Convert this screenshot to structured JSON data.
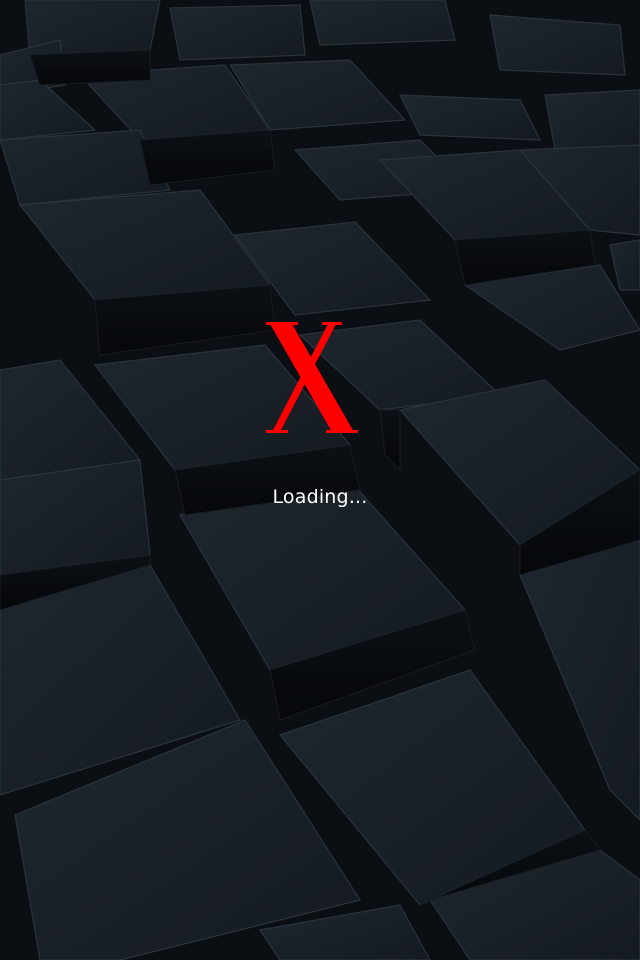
{
  "splash": {
    "logo_icon": "red-x-logo-icon",
    "loading_text": "Loading...",
    "background": "dark-3d-cubes",
    "colors": {
      "logo": "#ff0000",
      "text": "#ffffff",
      "background": "#11161b"
    }
  }
}
